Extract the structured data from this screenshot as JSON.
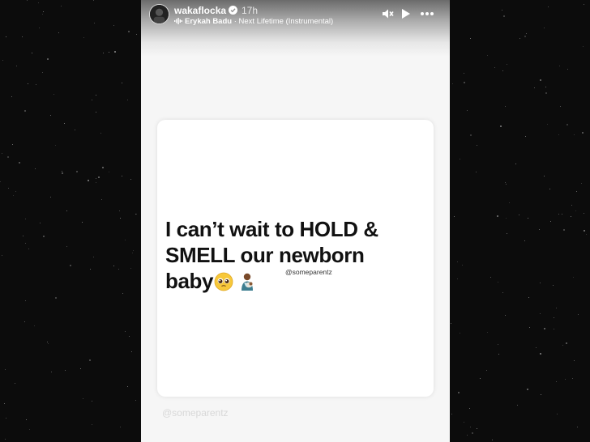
{
  "story": {
    "username": "wakaflocka",
    "time": "17h",
    "music": {
      "artist": "Erykah Badu",
      "separator": "·",
      "track": "Next Lifetime (Instrumental)"
    },
    "controls": [
      "mute-icon",
      "play-icon",
      "more-icon"
    ]
  },
  "card": {
    "lines": [
      "I can’t wait to HOLD &",
      "SMELL our newborn",
      "baby"
    ],
    "emojis": [
      "pleading-face-emoji",
      "person-feeding-baby-emoji"
    ],
    "watermark": "@someparentz"
  },
  "footer_handle": "@someparentz",
  "colors": {
    "background": "#0b0b0b",
    "story_bg": "#f6f6f6",
    "card_bg": "#ffffff",
    "text": "#111111"
  }
}
